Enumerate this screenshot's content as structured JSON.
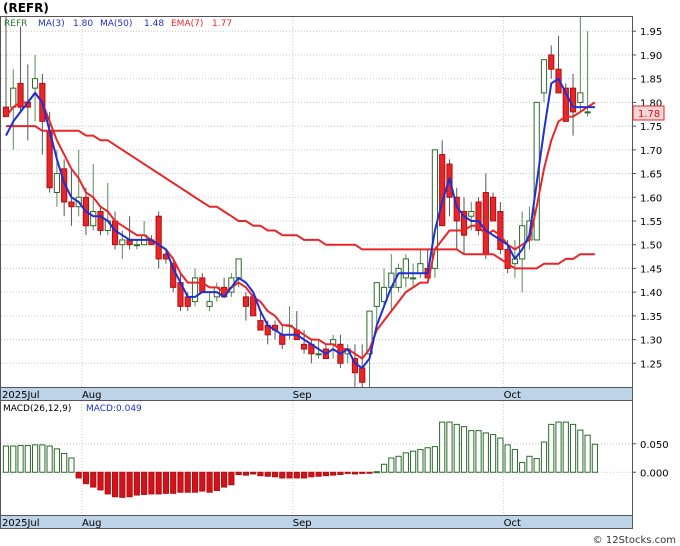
{
  "header": {
    "title": "(REFR)",
    "watermark": "© 12Stocks.com"
  },
  "colors": {
    "up": "#2a6a2a",
    "down": "#e8262a",
    "ma_fast": "#1f2fd0",
    "ma_slow": "#e8262a",
    "axis_strip": "#bcd3e8",
    "price_tag_bg": "#f6d5d5",
    "grid": "#c8c8c8",
    "macd_bar_up": "#2a6a2a",
    "macd_bar_down": "#d4121c"
  },
  "legend": {
    "symbol": "REFR",
    "ma3_label": "MA(3)",
    "ma3_value": "1.80",
    "ma50_label": "MA(50)",
    "ma50_value": "1.48",
    "ema7_label": "EMA(7)",
    "ema7_value": "1.77"
  },
  "macd_legend": {
    "params": "MACD(26,12,9)",
    "value_label": "MACD:0.049"
  },
  "last_price_tag": "1.78",
  "chart_data": [
    {
      "type": "candlestick",
      "title": "REFR",
      "ylim": [
        1.2,
        1.98
      ],
      "yticks": [
        1.25,
        1.3,
        1.35,
        1.4,
        1.45,
        1.5,
        1.55,
        1.6,
        1.65,
        1.7,
        1.75,
        1.8,
        1.85,
        1.9,
        1.95
      ],
      "ytick_labels": [
        "1.25",
        "1.30",
        "1.35",
        "1.40",
        "1.45",
        "1.50",
        "1.55",
        "1.60",
        "1.65",
        "1.70",
        "1.75",
        "1.80",
        "1.85",
        "1.90",
        "1.95"
      ],
      "x_labels": [
        {
          "index": 0,
          "label": "2025Jul"
        },
        {
          "index": 11,
          "label": "Aug"
        },
        {
          "index": 40,
          "label": "Sep"
        },
        {
          "index": 69,
          "label": "Oct"
        }
      ],
      "grid": true,
      "ohlc": [
        [
          1.79,
          1.98,
          1.77,
          1.77
        ],
        [
          1.79,
          1.87,
          1.7,
          1.83
        ],
        [
          1.84,
          1.96,
          1.78,
          1.79
        ],
        [
          1.8,
          1.88,
          1.72,
          1.79
        ],
        [
          1.83,
          1.9,
          1.76,
          1.85
        ],
        [
          1.84,
          1.86,
          1.69,
          1.76
        ],
        [
          1.74,
          1.78,
          1.61,
          1.62
        ],
        [
          1.61,
          1.7,
          1.58,
          1.65
        ],
        [
          1.66,
          1.68,
          1.56,
          1.59
        ],
        [
          1.59,
          1.66,
          1.54,
          1.58
        ],
        [
          1.58,
          1.7,
          1.56,
          1.6
        ],
        [
          1.6,
          1.62,
          1.52,
          1.54
        ],
        [
          1.54,
          1.67,
          1.53,
          1.57
        ],
        [
          1.57,
          1.58,
          1.52,
          1.53
        ],
        [
          1.53,
          1.63,
          1.52,
          1.55
        ],
        [
          1.55,
          1.57,
          1.49,
          1.5
        ],
        [
          1.5,
          1.53,
          1.47,
          1.51
        ],
        [
          1.51,
          1.56,
          1.49,
          1.5
        ],
        [
          1.5,
          1.51,
          1.49,
          1.5
        ],
        [
          1.5,
          1.55,
          1.5,
          1.52
        ],
        [
          1.51,
          1.52,
          1.5,
          1.5
        ],
        [
          1.56,
          1.57,
          1.45,
          1.47
        ],
        [
          1.48,
          1.49,
          1.46,
          1.47
        ],
        [
          1.46,
          1.47,
          1.4,
          1.41
        ],
        [
          1.42,
          1.44,
          1.36,
          1.37
        ],
        [
          1.39,
          1.4,
          1.36,
          1.37
        ],
        [
          1.38,
          1.45,
          1.37,
          1.43
        ],
        [
          1.43,
          1.44,
          1.4,
          1.4
        ],
        [
          1.37,
          1.4,
          1.36,
          1.38
        ],
        [
          1.39,
          1.42,
          1.38,
          1.41
        ],
        [
          1.41,
          1.43,
          1.39,
          1.39
        ],
        [
          1.4,
          1.44,
          1.39,
          1.43
        ],
        [
          1.43,
          1.47,
          1.41,
          1.47
        ],
        [
          1.39,
          1.4,
          1.34,
          1.37
        ],
        [
          1.39,
          1.4,
          1.35,
          1.35
        ],
        [
          1.34,
          1.36,
          1.32,
          1.32
        ],
        [
          1.33,
          1.34,
          1.29,
          1.31
        ],
        [
          1.33,
          1.34,
          1.3,
          1.32
        ],
        [
          1.31,
          1.33,
          1.28,
          1.29
        ],
        [
          1.33,
          1.37,
          1.3,
          1.33
        ],
        [
          1.32,
          1.36,
          1.3,
          1.3
        ],
        [
          1.29,
          1.32,
          1.27,
          1.28
        ],
        [
          1.29,
          1.3,
          1.25,
          1.27
        ],
        [
          1.27,
          1.3,
          1.26,
          1.27
        ],
        [
          1.28,
          1.29,
          1.26,
          1.26
        ],
        [
          1.29,
          1.31,
          1.26,
          1.3
        ],
        [
          1.29,
          1.31,
          1.24,
          1.25
        ],
        [
          1.27,
          1.29,
          1.25,
          1.28
        ],
        [
          1.26,
          1.29,
          1.2,
          1.23
        ],
        [
          1.24,
          1.29,
          1.2,
          1.21
        ],
        [
          1.27,
          1.36,
          1.2,
          1.36
        ],
        [
          1.37,
          1.41,
          1.33,
          1.42
        ],
        [
          1.38,
          1.45,
          1.37,
          1.41
        ],
        [
          1.41,
          1.48,
          1.36,
          1.44
        ],
        [
          1.41,
          1.46,
          1.4,
          1.45
        ],
        [
          1.43,
          1.48,
          1.41,
          1.47
        ],
        [
          1.43,
          1.46,
          1.41,
          1.43
        ],
        [
          1.44,
          1.49,
          1.43,
          1.46
        ],
        [
          1.45,
          1.49,
          1.44,
          1.43
        ],
        [
          1.45,
          1.7,
          1.43,
          1.7
        ],
        [
          1.69,
          1.72,
          1.55,
          1.54
        ],
        [
          1.67,
          1.68,
          1.56,
          1.6
        ],
        [
          1.6,
          1.62,
          1.49,
          1.55
        ],
        [
          1.57,
          1.6,
          1.48,
          1.52
        ],
        [
          1.56,
          1.59,
          1.53,
          1.57
        ],
        [
          1.59,
          1.6,
          1.52,
          1.53
        ],
        [
          1.61,
          1.65,
          1.47,
          1.48
        ],
        [
          1.6,
          1.61,
          1.55,
          1.55
        ],
        [
          1.57,
          1.59,
          1.48,
          1.49
        ],
        [
          1.49,
          1.51,
          1.44,
          1.45
        ],
        [
          1.46,
          1.51,
          1.43,
          1.47
        ],
        [
          1.47,
          1.57,
          1.4,
          1.54
        ],
        [
          1.51,
          1.58,
          1.49,
          1.55
        ],
        [
          1.51,
          1.8,
          1.51,
          1.8
        ],
        [
          1.82,
          1.89,
          1.8,
          1.89
        ],
        [
          1.9,
          1.92,
          1.85,
          1.87
        ],
        [
          1.87,
          1.94,
          1.82,
          1.82
        ],
        [
          1.83,
          1.84,
          1.76,
          1.76
        ],
        [
          1.83,
          1.86,
          1.73,
          1.78
        ],
        [
          1.8,
          1.98,
          1.78,
          1.82
        ],
        [
          1.78,
          1.95,
          1.77,
          1.78
        ]
      ],
      "ma50": [
        1.75,
        1.75,
        1.75,
        1.75,
        1.75,
        1.74,
        1.74,
        1.74,
        1.74,
        1.74,
        1.74,
        1.73,
        1.73,
        1.72,
        1.72,
        1.71,
        1.7,
        1.69,
        1.68,
        1.67,
        1.66,
        1.65,
        1.64,
        1.63,
        1.62,
        1.61,
        1.6,
        1.59,
        1.58,
        1.58,
        1.57,
        1.56,
        1.55,
        1.55,
        1.54,
        1.54,
        1.53,
        1.53,
        1.52,
        1.52,
        1.52,
        1.51,
        1.51,
        1.51,
        1.5,
        1.5,
        1.5,
        1.5,
        1.5,
        1.49,
        1.49,
        1.49,
        1.49,
        1.49,
        1.49,
        1.49,
        1.49,
        1.49,
        1.49,
        1.49,
        1.49,
        1.49,
        1.49,
        1.48,
        1.48,
        1.48,
        1.48,
        1.48,
        1.47,
        1.46,
        1.45,
        1.45,
        1.45,
        1.45,
        1.46,
        1.46,
        1.46,
        1.47,
        1.47,
        1.48,
        1.48,
        1.48
      ],
      "ma3": [
        1.73,
        1.76,
        1.78,
        1.8,
        1.82,
        1.8,
        1.74,
        1.68,
        1.63,
        1.6,
        1.59,
        1.57,
        1.56,
        1.56,
        1.55,
        1.53,
        1.52,
        1.51,
        1.51,
        1.51,
        1.51,
        1.5,
        1.49,
        1.45,
        1.42,
        1.39,
        1.39,
        1.4,
        1.4,
        1.4,
        1.39,
        1.41,
        1.43,
        1.42,
        1.4,
        1.36,
        1.33,
        1.32,
        1.31,
        1.31,
        1.31,
        1.3,
        1.29,
        1.28,
        1.27,
        1.28,
        1.27,
        1.28,
        1.25,
        1.24,
        1.26,
        1.33,
        1.37,
        1.41,
        1.44,
        1.44,
        1.44,
        1.44,
        1.44,
        1.53,
        1.59,
        1.64,
        1.58,
        1.56,
        1.55,
        1.55,
        1.53,
        1.52,
        1.51,
        1.5,
        1.47,
        1.49,
        1.52,
        1.63,
        1.74,
        1.84,
        1.85,
        1.82,
        1.79,
        1.79,
        1.79,
        1.79
      ],
      "ema7": [
        1.77,
        1.79,
        1.8,
        1.8,
        1.82,
        1.8,
        1.76,
        1.72,
        1.69,
        1.66,
        1.64,
        1.61,
        1.6,
        1.58,
        1.57,
        1.55,
        1.54,
        1.53,
        1.52,
        1.52,
        1.51,
        1.5,
        1.49,
        1.47,
        1.44,
        1.42,
        1.42,
        1.42,
        1.41,
        1.41,
        1.4,
        1.41,
        1.42,
        1.41,
        1.39,
        1.38,
        1.36,
        1.35,
        1.33,
        1.33,
        1.32,
        1.31,
        1.3,
        1.3,
        1.29,
        1.29,
        1.28,
        1.28,
        1.27,
        1.26,
        1.28,
        1.32,
        1.34,
        1.36,
        1.38,
        1.4,
        1.41,
        1.42,
        1.42,
        1.49,
        1.51,
        1.53,
        1.53,
        1.53,
        1.54,
        1.54,
        1.52,
        1.53,
        1.52,
        1.5,
        1.49,
        1.5,
        1.51,
        1.58,
        1.66,
        1.72,
        1.76,
        1.77,
        1.77,
        1.78,
        1.79,
        1.8
      ]
    },
    {
      "type": "bar",
      "title": "MACD(26,12,9)",
      "ylim": [
        -0.075,
        0.125
      ],
      "yticks": [
        0.0,
        0.05
      ],
      "ytick_labels": [
        "0.000",
        "0.050"
      ],
      "values": [
        0.046,
        0.046,
        0.047,
        0.047,
        0.048,
        0.048,
        0.046,
        0.041,
        0.033,
        0.025,
        -0.01,
        -0.02,
        -0.026,
        -0.031,
        -0.038,
        -0.043,
        -0.044,
        -0.043,
        -0.04,
        -0.039,
        -0.038,
        -0.038,
        -0.037,
        -0.037,
        -0.035,
        -0.035,
        -0.035,
        -0.033,
        -0.035,
        -0.032,
        -0.026,
        -0.022,
        -0.004,
        -0.005,
        -0.003,
        -0.006,
        -0.007,
        -0.008,
        -0.01,
        -0.01,
        -0.01,
        -0.01,
        -0.008,
        -0.007,
        -0.006,
        -0.005,
        -0.004,
        -0.002,
        -0.003,
        -0.002,
        -0.001,
        0.001,
        0.014,
        0.025,
        0.028,
        0.034,
        0.037,
        0.04,
        0.043,
        0.045,
        0.088,
        0.088,
        0.084,
        0.08,
        0.073,
        0.073,
        0.069,
        0.066,
        0.06,
        0.048,
        0.04,
        0.017,
        0.028,
        0.024,
        0.053,
        0.084,
        0.088,
        0.088,
        0.084,
        0.074,
        0.065,
        0.049
      ]
    }
  ]
}
